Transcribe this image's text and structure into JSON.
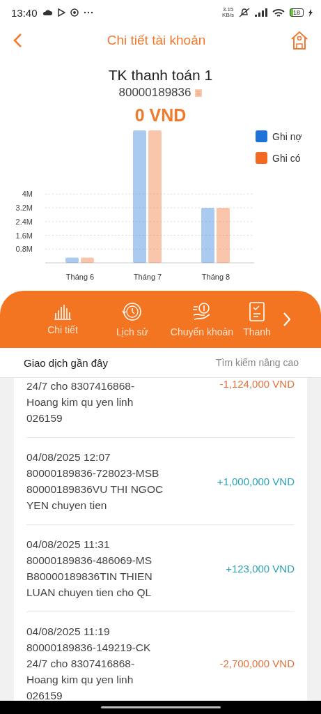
{
  "status_bar": {
    "time": "13:40",
    "net_speed": "3.15\nKB/s",
    "battery": "18"
  },
  "header": {
    "title": "Chi tiết tài khoản"
  },
  "account": {
    "name": "TK thanh toán 1",
    "number": "80000189836",
    "balance": "0 VND"
  },
  "chart_data": {
    "type": "bar",
    "categories": [
      "Tháng 6",
      "Tháng 7",
      "Tháng 8"
    ],
    "series": [
      {
        "name": "Ghi nợ",
        "color": "#1f73d8",
        "values": [
          0.3,
          7.7,
          3.2
        ]
      },
      {
        "name": "Ghi có",
        "color": "#f26a21",
        "values": [
          0.3,
          7.7,
          3.2
        ]
      }
    ],
    "grid": true,
    "legend": true,
    "ylim": [
      0,
      7.7
    ],
    "yticks": [
      {
        "value": 0.8,
        "label": "0.8M"
      },
      {
        "value": 1.6,
        "label": "1.6M"
      },
      {
        "value": 2.4,
        "label": "2.4M"
      },
      {
        "value": 3.2,
        "label": "3.2M"
      },
      {
        "value": 4,
        "label": "4M"
      }
    ]
  },
  "actions": [
    {
      "label": "Chi tiết",
      "kind": "bars"
    },
    {
      "label": "Lịch sử",
      "kind": "history"
    },
    {
      "label": "Chuyển khoản",
      "kind": "transfer"
    },
    {
      "label": "Thanh",
      "kind": "bill"
    }
  ],
  "transactions": {
    "title": "Giao dịch gần đây",
    "advanced_search": "Tìm kiếm nâng cao",
    "items": [
      {
        "description": "24/7 cho 8307416868-\nHoang kim qu yen linh\n026159",
        "amount": "-1,124,000 VND",
        "kind": "debit"
      },
      {
        "description": "04/08/2025 12:07\n80000189836-728023-MSB\n80000189836VU THI NGOC\nYEN chuyen tien",
        "amount": "+1,000,000 VND",
        "kind": "credit"
      },
      {
        "description": "04/08/2025 11:31\n80000189836-486069-MS\nB80000189836TIN THIEN\nLUAN chuyen tien cho QL",
        "amount": "+123,000 VND",
        "kind": "credit"
      },
      {
        "description": "04/08/2025 11:19\n80000189836-149219-CK\n24/7 cho 8307416868-\nHoang kim qu yen linh\n026159",
        "amount": "-2,700,000 VND",
        "kind": "debit"
      }
    ]
  }
}
